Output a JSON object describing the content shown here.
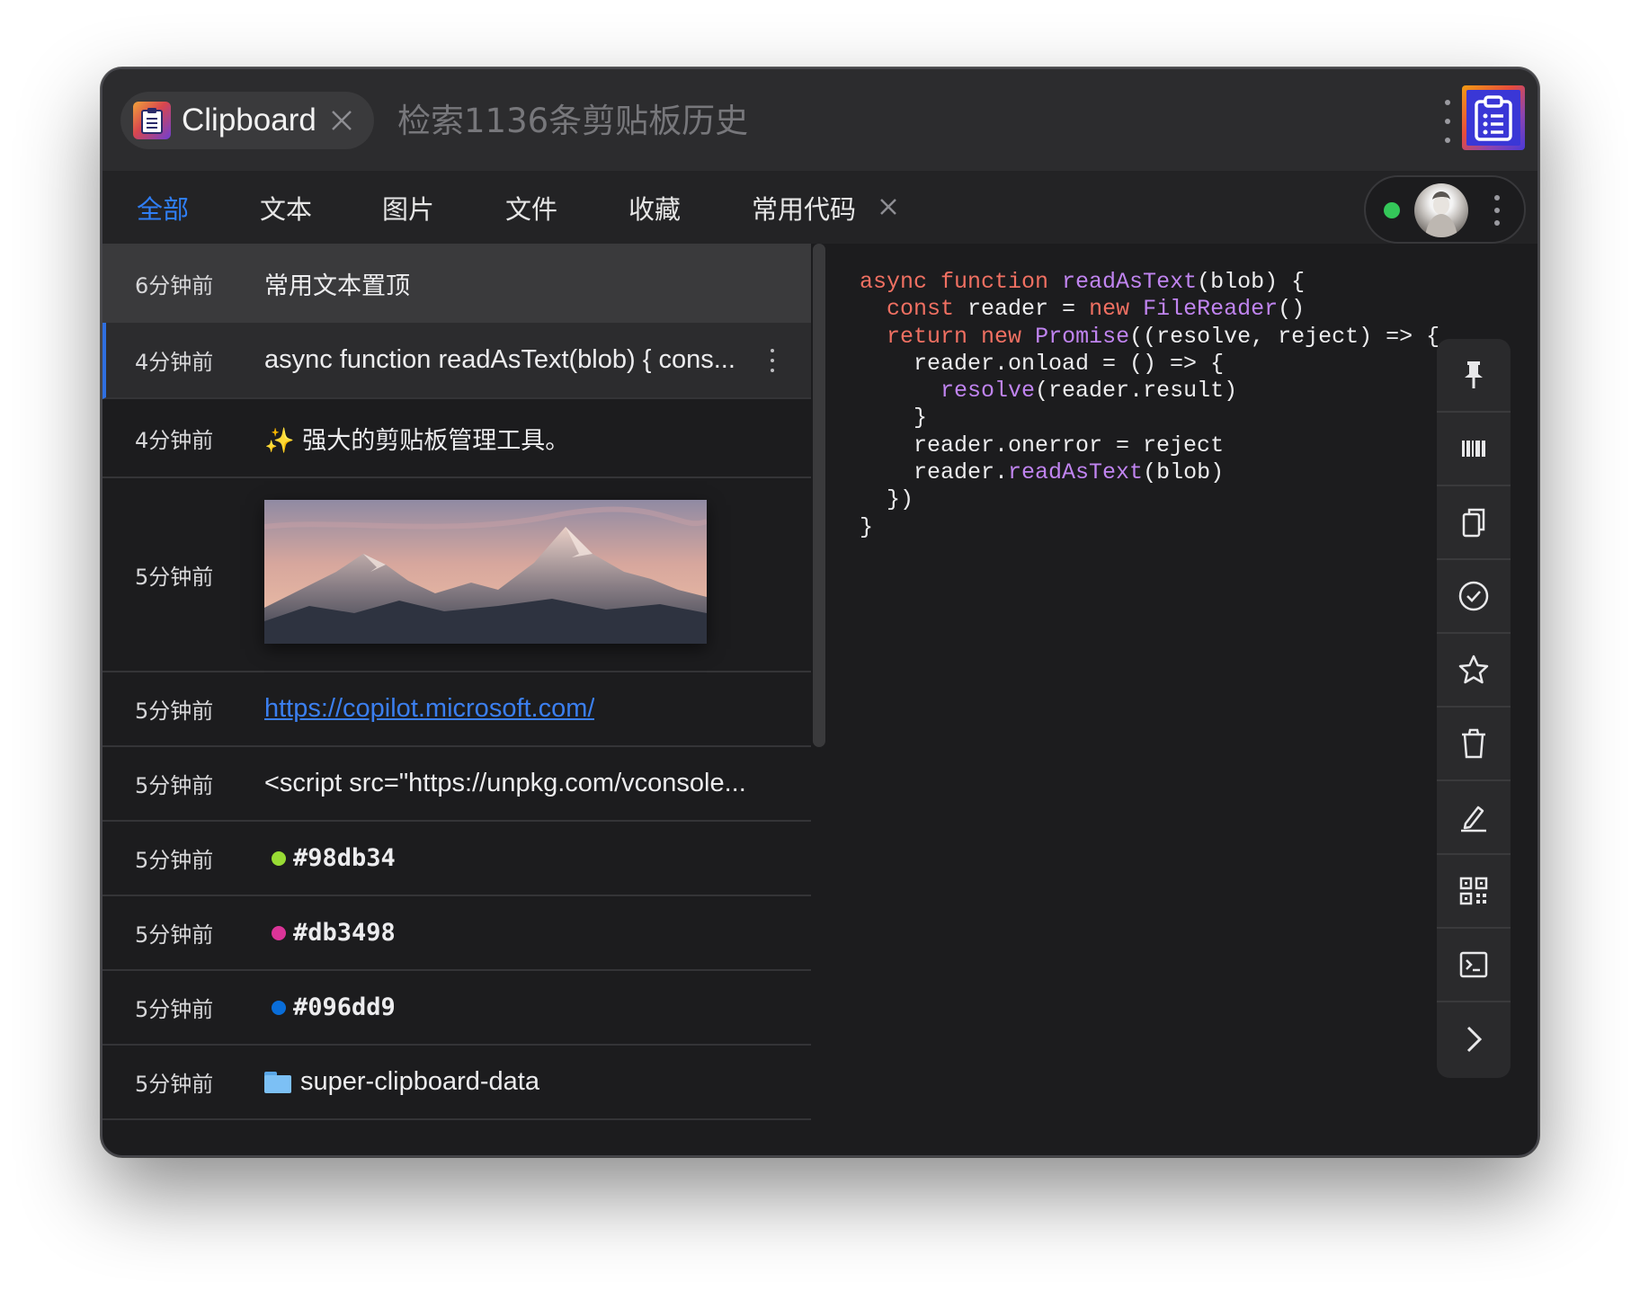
{
  "window": {
    "chip_label": "Clipboard",
    "search_placeholder": "检索1136条剪贴板历史"
  },
  "tabs": [
    {
      "label": "全部",
      "active": true
    },
    {
      "label": "文本",
      "active": false
    },
    {
      "label": "图片",
      "active": false
    },
    {
      "label": "文件",
      "active": false
    },
    {
      "label": "收藏",
      "active": false
    },
    {
      "label": "常用代码",
      "active": false
    }
  ],
  "account": {
    "status_color": "#34c759"
  },
  "list": [
    {
      "time": "6分钟前",
      "text": "常用文本置顶"
    },
    {
      "time": "4分钟前",
      "text": "async function readAsText(blob) { cons..."
    },
    {
      "time": "4分钟前",
      "text": "✨ 强大的剪贴板管理工具。"
    },
    {
      "time": "5分钟前",
      "kind": "image"
    },
    {
      "time": "5分钟前",
      "text": "https://copilot.microsoft.com/"
    },
    {
      "time": "5分钟前",
      "text": "<script src=\"https://unpkg.com/vconsole..."
    },
    {
      "time": "5分钟前",
      "text": "#98db34",
      "color": "#98db34"
    },
    {
      "time": "5分钟前",
      "text": "#db3498",
      "color": "#db3498"
    },
    {
      "time": "5分钟前",
      "text": "#096dd9",
      "color": "#096dd9"
    },
    {
      "time": "5分钟前",
      "text": "super-clipboard-data"
    }
  ],
  "preview": {
    "lines": [
      [
        "async ",
        "function ",
        "readAsText",
        "(blob) {"
      ],
      [
        "  ",
        "const ",
        "reader = ",
        "new ",
        "FileReader",
        "()"
      ],
      [
        "  ",
        "return ",
        "new ",
        "Promise",
        "((resolve, reject) => {"
      ],
      [
        "    reader.onload = () => {"
      ],
      [
        "      ",
        "resolve",
        "(reader.result)"
      ],
      [
        "    }"
      ],
      [
        "    reader.onerror = reject"
      ],
      [
        "    reader.",
        "readAsText",
        "(blob)"
      ],
      [
        "  })"
      ],
      [
        "}"
      ]
    ]
  },
  "actions": [
    "pin-icon",
    "barcode-icon",
    "copy-icon",
    "check-circle-icon",
    "star-icon",
    "trash-icon",
    "edit-icon",
    "qrcode-icon",
    "terminal-icon",
    "chevron-right-icon"
  ]
}
